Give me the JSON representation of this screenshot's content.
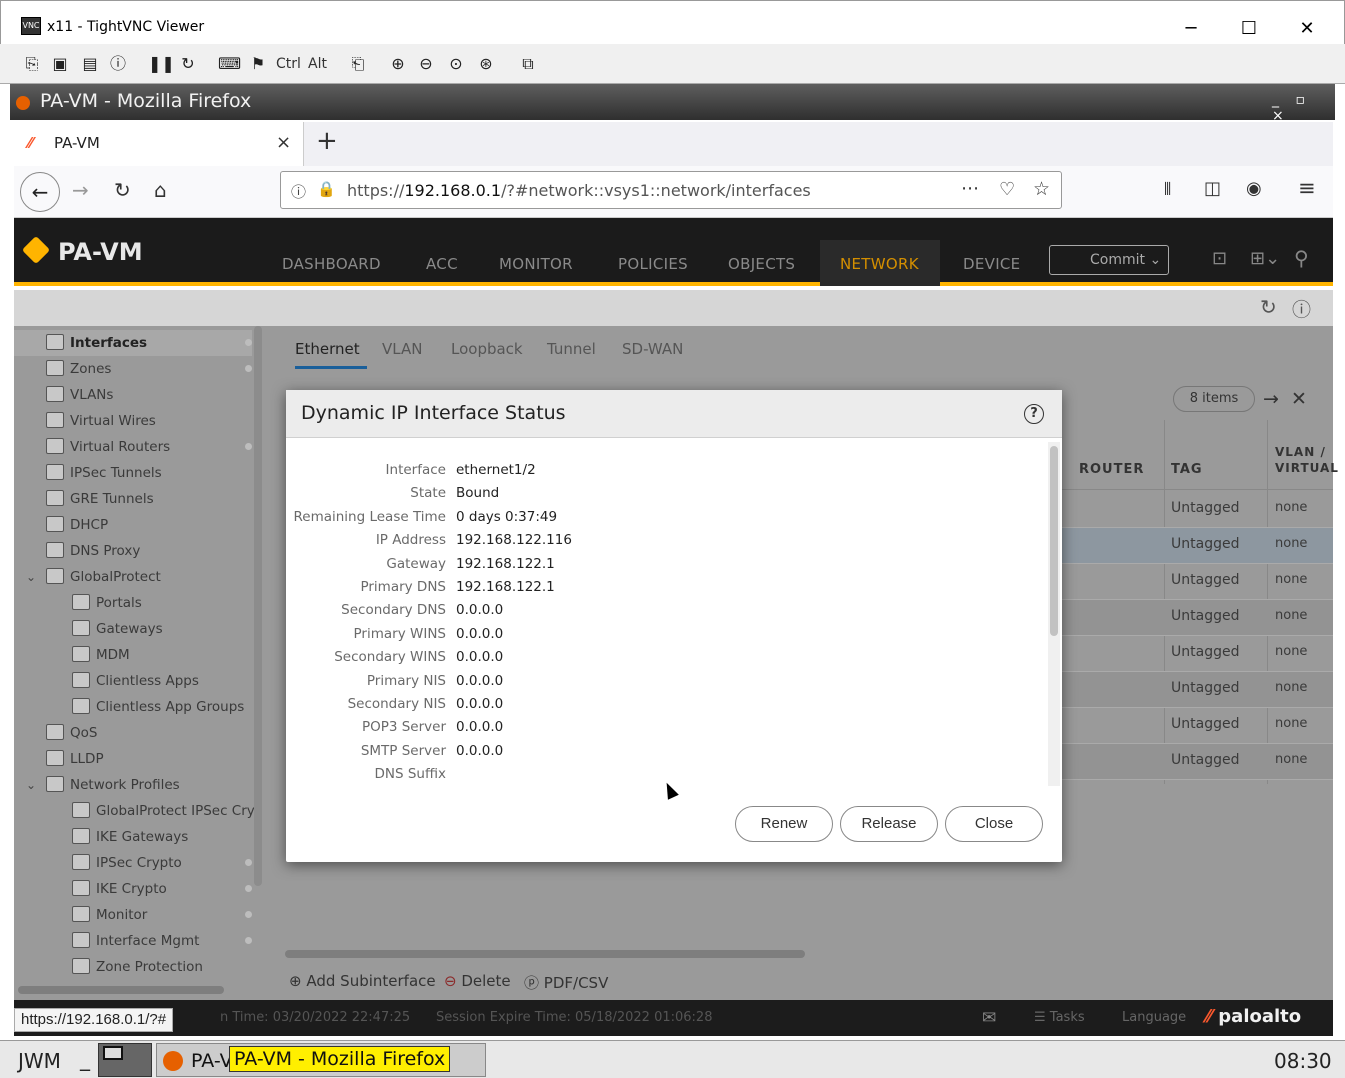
{
  "vnc": {
    "title": "x11 - TightVNC Viewer",
    "toolbar_icons": [
      "new-connection-icon",
      "save-icon",
      "options-icon",
      "info-icon",
      "pause-icon",
      "refresh-icon",
      "ctrl-alt-del-icon",
      "ctrl-esc-icon",
      "ctrl-key-icon",
      "alt-key-icon",
      "clipboard-icon",
      "zoom-in-icon",
      "zoom-out-icon",
      "zoom-100-icon",
      "zoom-fit-icon",
      "fullscreen-icon"
    ],
    "ctrl_label": "Ctrl",
    "alt_label": "Alt"
  },
  "firefox": {
    "window_title": "PA-VM - Mozilla Firefox",
    "tab_title": "PA-VM",
    "new_tab": "+",
    "url_prefix": "https://",
    "url_host": "192.168.0.1",
    "url_path": "/?#network::vsys1::network/interfaces",
    "status_link": "https://192.168.0.1/?#"
  },
  "pa": {
    "brand": "PA-VM",
    "nav": [
      "DASHBOARD",
      "ACC",
      "MONITOR",
      "POLICIES",
      "OBJECTS",
      "NETWORK",
      "DEVICE"
    ],
    "active_nav": "NETWORK",
    "commit_label": "Commit",
    "accent_color": "#ffb400",
    "sidebar": [
      {
        "label": "Interfaces",
        "indent": 0,
        "bold": true,
        "dot": true
      },
      {
        "label": "Zones",
        "indent": 0,
        "dot": true
      },
      {
        "label": "VLANs",
        "indent": 0
      },
      {
        "label": "Virtual Wires",
        "indent": 0
      },
      {
        "label": "Virtual Routers",
        "indent": 0,
        "dot": true
      },
      {
        "label": "IPSec Tunnels",
        "indent": 0
      },
      {
        "label": "GRE Tunnels",
        "indent": 0
      },
      {
        "label": "DHCP",
        "indent": 0
      },
      {
        "label": "DNS Proxy",
        "indent": 0
      },
      {
        "label": "GlobalProtect",
        "indent": 0,
        "expand": true
      },
      {
        "label": "Portals",
        "indent": 1
      },
      {
        "label": "Gateways",
        "indent": 1
      },
      {
        "label": "MDM",
        "indent": 1
      },
      {
        "label": "Clientless Apps",
        "indent": 1
      },
      {
        "label": "Clientless App Groups",
        "indent": 1
      },
      {
        "label": "QoS",
        "indent": 0
      },
      {
        "label": "LLDP",
        "indent": 0
      },
      {
        "label": "Network Profiles",
        "indent": 0,
        "expand": true
      },
      {
        "label": "GlobalProtect IPSec Cry",
        "indent": 1
      },
      {
        "label": "IKE Gateways",
        "indent": 1
      },
      {
        "label": "IPSec Crypto",
        "indent": 1,
        "dot": true
      },
      {
        "label": "IKE Crypto",
        "indent": 1,
        "dot": true
      },
      {
        "label": "Monitor",
        "indent": 1,
        "dot": true
      },
      {
        "label": "Interface Mgmt",
        "indent": 1,
        "dot": true
      },
      {
        "label": "Zone Protection",
        "indent": 1
      }
    ],
    "tabs": [
      "Ethernet",
      "VLAN",
      "Loopback",
      "Tunnel",
      "SD-WAN"
    ],
    "active_tab": "Ethernet",
    "items_count": "8 items",
    "columns": [
      "ROUTER",
      "TAG",
      "VLAN / VIRTUAL"
    ],
    "rows": [
      {
        "tag": "Untagged",
        "vlan": "none"
      },
      {
        "tag": "Untagged",
        "vlan": "none"
      },
      {
        "tag": "Untagged",
        "vlan": "none"
      },
      {
        "tag": "Untagged",
        "vlan": "none"
      },
      {
        "tag": "Untagged",
        "vlan": "none"
      },
      {
        "tag": "Untagged",
        "vlan": "none"
      },
      {
        "tag": "Untagged",
        "vlan": "none"
      },
      {
        "tag": "Untagged",
        "vlan": "none"
      }
    ],
    "bottom_actions": [
      "Add Subinterface",
      "Delete",
      "PDF/CSV"
    ],
    "status_left": "n Time: 03/20/2022 22:47:25",
    "status_session": "Session Expire Time: 05/18/2022 01:06:28",
    "status_tasks": "Tasks",
    "status_language": "Language",
    "vendor": "paloalto"
  },
  "modal": {
    "title": "Dynamic IP Interface Status",
    "fields": [
      {
        "label": "Interface",
        "value": "ethernet1/2"
      },
      {
        "label": "State",
        "value": "Bound"
      },
      {
        "label": "Remaining Lease Time",
        "value": "0 days 0:37:49"
      },
      {
        "label": "IP Address",
        "value": "192.168.122.116"
      },
      {
        "label": "Gateway",
        "value": "192.168.122.1"
      },
      {
        "label": "Primary DNS",
        "value": "192.168.122.1"
      },
      {
        "label": "Secondary DNS",
        "value": "0.0.0.0"
      },
      {
        "label": "Primary WINS",
        "value": "0.0.0.0"
      },
      {
        "label": "Secondary WINS",
        "value": "0.0.0.0"
      },
      {
        "label": "Primary NIS",
        "value": "0.0.0.0"
      },
      {
        "label": "Secondary NIS",
        "value": "0.0.0.0"
      },
      {
        "label": "POP3 Server",
        "value": "0.0.0.0"
      },
      {
        "label": "SMTP Server",
        "value": "0.0.0.0"
      },
      {
        "label": "DNS Suffix",
        "value": ""
      }
    ],
    "buttons": {
      "renew": "Renew",
      "release": "Release",
      "close": "Close"
    }
  },
  "taskbar": {
    "wm": "JWM",
    "minimize": "_",
    "task_prefix": "PA-V",
    "task_title": "PA-VM - Mozilla Firefox",
    "clock": "08:30"
  }
}
